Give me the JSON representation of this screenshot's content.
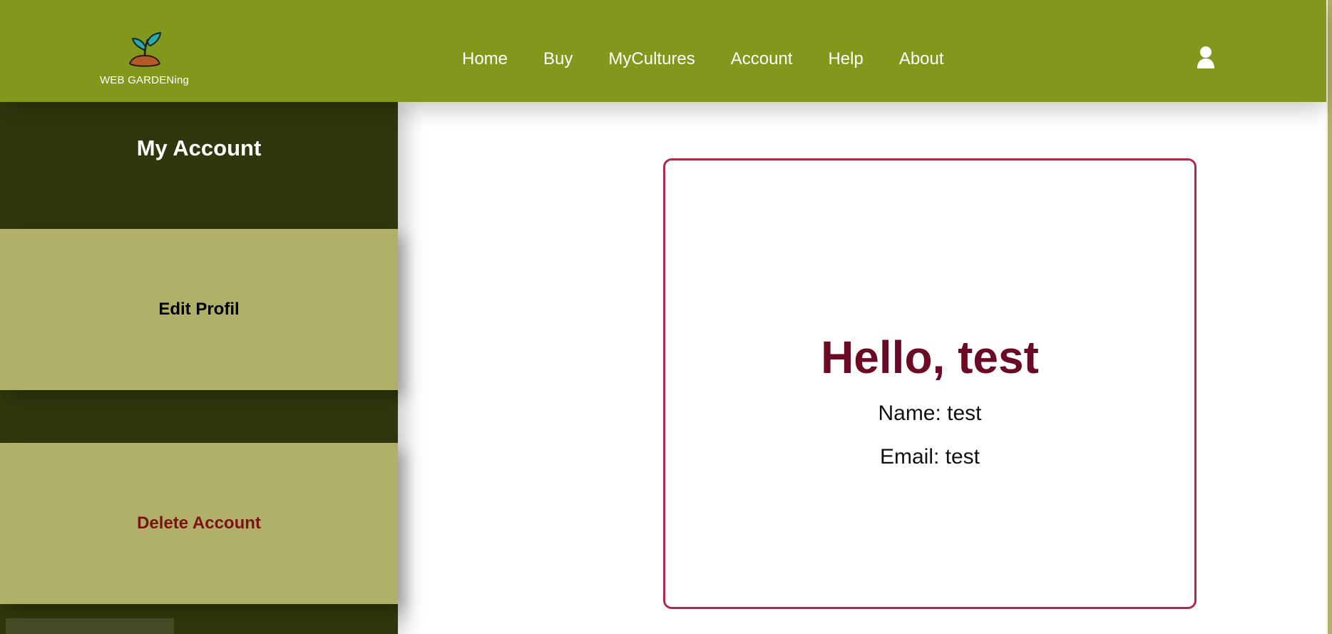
{
  "brand": {
    "name": "WEB GARDENing",
    "logo_icon": "plant-sprout-icon"
  },
  "nav": {
    "items": [
      {
        "label": "Home"
      },
      {
        "label": "Buy"
      },
      {
        "label": "MyCultures"
      },
      {
        "label": "Account"
      },
      {
        "label": "Help"
      },
      {
        "label": "About"
      }
    ],
    "user_icon": "user-icon"
  },
  "sidebar": {
    "title": "My Account",
    "actions": [
      {
        "label": "Edit Profil"
      },
      {
        "label": "Delete Account"
      }
    ]
  },
  "profile": {
    "greeting": "Hello, test",
    "name_line": "Name: test",
    "email_line": "Email: test"
  },
  "colors": {
    "topbar": "#81981c",
    "sidebar": "#30370c",
    "sidebar_button": "#b0b069",
    "delete_text": "#7c1313",
    "card_border": "#b0284b",
    "greeting_text": "#6a0a24"
  }
}
